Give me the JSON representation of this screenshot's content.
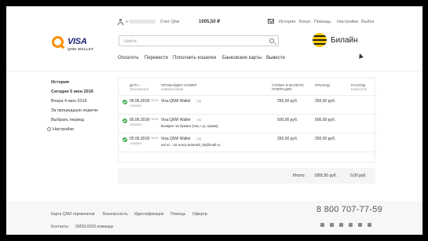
{
  "topbar": {
    "phone_prefix": "+",
    "account_label": "Счет Qiwi",
    "balance": "1005,50 ₽",
    "links": [
      "История",
      "Бонус",
      "Помощь",
      "Настройки",
      "Выйти"
    ]
  },
  "logo": {
    "brand": "VISA",
    "subtitle": "QIWI WALLET"
  },
  "search": {
    "placeholder": "Найти"
  },
  "banner": {
    "name": "Билайн"
  },
  "nav": [
    "Оплатить",
    "Перевести",
    "Пополнить кошелек",
    "Банковские карты",
    "Вывести"
  ],
  "sidebar": {
    "items": [
      "История",
      "Сегодня 5 июн 2016",
      "Вчера 4 июн 2016",
      "За прошедшую неделю",
      "Выбрать период",
      "Настройки"
    ]
  },
  "table": {
    "headers": {
      "date": "ДАТА",
      "date_sub": "Транзакция",
      "provider": "ПРОВАЙДЕР НОМЕР",
      "provider_sub": "Комментарий",
      "amount": "СУММА В ВАЛЮТЕ",
      "amount_sub": "ОПЕРАЦИИ",
      "income": "ПРИХОД",
      "expense": "РАСХОД",
      "expense_sub": "Комиссия"
    },
    "rows": [
      {
        "date": "05.06.2016",
        "time": "07:31:00",
        "txn": "14000001",
        "provider": "Visa QIWI Wallet",
        "number": "7(9)",
        "comment": "",
        "amount": "250,00 руб.",
        "income": "250,00 руб.",
        "expense": ""
      },
      {
        "date": "05.06.2016",
        "time": "07:30:00",
        "txn": "14000002",
        "provider": "Visa QIWI Wallet",
        "number": "7(9)",
        "comment": "Возврат за бумаги (чек, с.р, права)",
        "amount": "500,00 руб.",
        "income": "500,00 руб.",
        "expense": ""
      },
      {
        "date": "05.06.2016",
        "time": "07:28:00",
        "txn": "14000003",
        "provider": "Visa QIWI Wallet",
        "number": "7(9)",
        "comment": "vel vc - na novry.anton93_93@mail.ru",
        "amount": "250,00 руб.",
        "income": "250,00 руб.",
        "expense": ""
      }
    ],
    "total_label": "Итого:",
    "total_income": "1005,50 руб.",
    "total_expense": "0,00 руб."
  },
  "footer": {
    "links": [
      "Карта QIWI терминалов",
      "Безопасность",
      "Идентификация",
      "Помощь",
      "Оферты"
    ],
    "contacts_label": "Контакты:",
    "contacts_link": "SMS/USSD-команды",
    "phone": "8 800 707-77-59"
  }
}
